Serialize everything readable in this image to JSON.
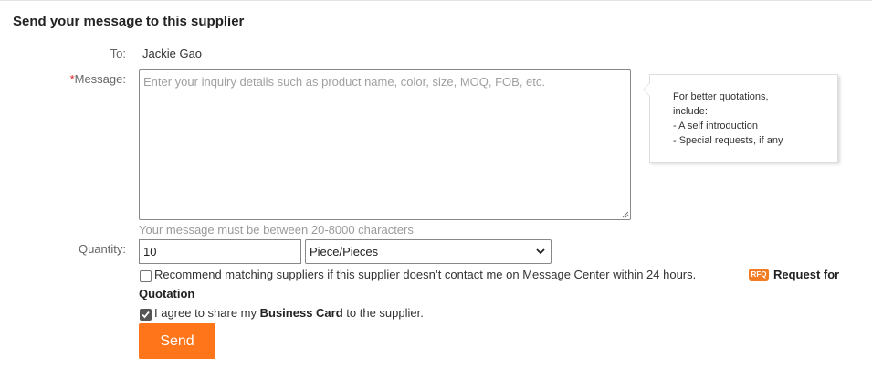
{
  "title": "Send your message to this supplier",
  "to": {
    "label": "To:",
    "value": "Jackie Gao"
  },
  "message": {
    "required_mark": "*",
    "label": "Message:",
    "placeholder": "Enter your inquiry details such as product name, color, size, MOQ, FOB, etc.",
    "hint": "Your message must be between 20-8000 characters"
  },
  "tip": {
    "line1": "For better quotations, include:",
    "line2": "- A self introduction",
    "line3": "- Special requests, if any"
  },
  "quantity": {
    "label": "Quantity:",
    "value": "10",
    "unit_selected": "Piece/Pieces"
  },
  "recommend": {
    "checked": false,
    "label": "Recommend matching suppliers if this supplier doesn’t contact me on Message Center within 24 hours.",
    "rfq_icon_text": "RFQ",
    "rfq_part1": "Request for",
    "rfq_part2": "Quotation"
  },
  "agree": {
    "checked": true,
    "prefix": "I agree to share my ",
    "bold": "Business Card",
    "suffix": " to the supplier."
  },
  "send_label": "Send",
  "colors": {
    "accent": "#ff7519",
    "rfq": "#f37b21",
    "required": "#e02020"
  }
}
